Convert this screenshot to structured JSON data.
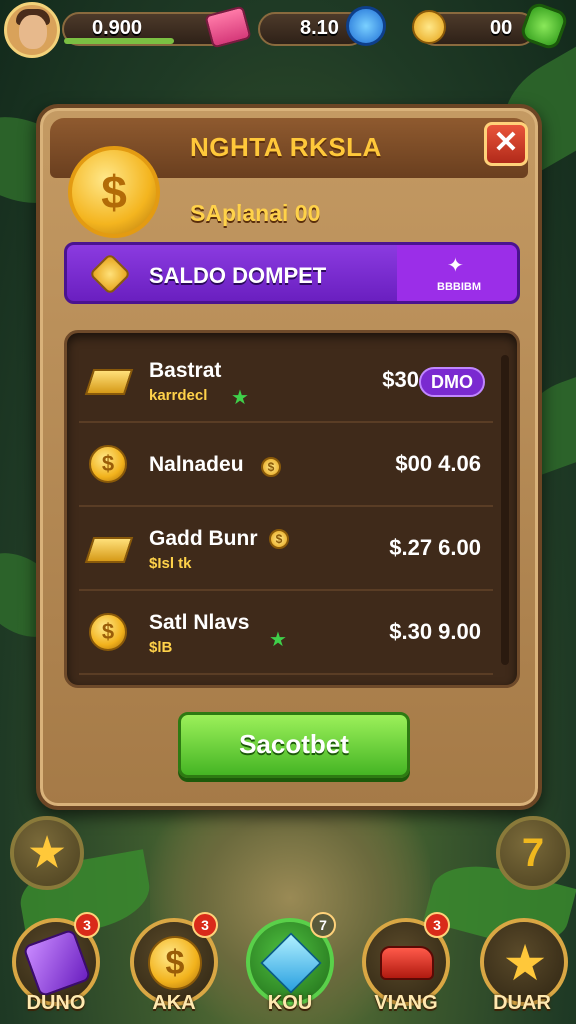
{
  "top_bar": {
    "gold_value": "0.900",
    "gems_value": "8.10",
    "coins_value": "00",
    "icons": [
      "avatar",
      "gold-bar-icon",
      "blue-gem-icon",
      "coin-icon",
      "green-gear-icon"
    ]
  },
  "panel": {
    "title": "NGHTA RKSLA",
    "close_label": "✕",
    "subtitle": "SAplanai 00",
    "wallet": {
      "label": "SALDO DOMPET",
      "side_label": "BBBIBM"
    },
    "rows": [
      {
        "name": "Bastrat",
        "sub": "karrdecl",
        "amount": "$30",
        "pill": "DMO",
        "icon": "gold-bar"
      },
      {
        "name": "Nalnadeu",
        "sub": "",
        "amount": "$00 4.06",
        "icon": "coin"
      },
      {
        "name": "Gadd Bunr",
        "sub": "$Isl tk",
        "amount": "$.27 6.00",
        "icon": "gold-bar"
      },
      {
        "name": "Satl Nlavs",
        "sub": "$lB",
        "amount": "$.30 9.00",
        "icon": "coin"
      }
    ],
    "cta_label": "Sacotbet"
  },
  "side_buttons": {
    "left": "★",
    "right": "7"
  },
  "bottom_nav": [
    {
      "label": "DUNO",
      "badge": "3",
      "icon": "purple-gem"
    },
    {
      "label": "AKA",
      "badge": "3",
      "icon": "gold-coin"
    },
    {
      "label": "KOU",
      "badge": "7",
      "icon": "blue-crystal"
    },
    {
      "label": "VIANG",
      "badge": "3",
      "icon": "red-car"
    },
    {
      "label": "DUAR",
      "badge": "",
      "icon": "gold-star"
    }
  ],
  "colors": {
    "accent_gold": "#ffc83a",
    "wallet_purple": "#8b3be0",
    "cta_green": "#45b524",
    "badge_red": "#d92a1a"
  }
}
